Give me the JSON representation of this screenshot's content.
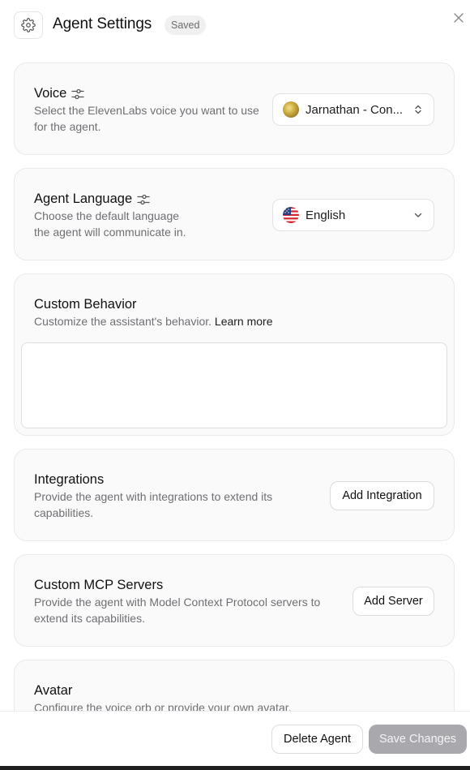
{
  "header": {
    "title": "Agent Settings",
    "badge": "Saved"
  },
  "voice": {
    "title": "Voice",
    "description": "Select the ElevenLabs voice you want to use for the agent.",
    "selected": "Jarnathan - Con..."
  },
  "language": {
    "title": "Agent Language",
    "description_line1": "Choose the default language",
    "description_line2": "the agent will communicate in.",
    "selected": "English"
  },
  "behavior": {
    "title": "Custom Behavior",
    "description": "Customize the assistant's behavior.",
    "learn_more": "Learn more",
    "value": ""
  },
  "integrations": {
    "title": "Integrations",
    "description": "Provide the agent with integrations to extend its capabilities.",
    "button": "Add Integration"
  },
  "mcp": {
    "title": "Custom MCP Servers",
    "description": "Provide the agent with Model Context Protocol servers to extend its capabilities.",
    "button": "Add Server"
  },
  "avatar": {
    "title": "Avatar",
    "description": "Configure the voice orb or provide your own avatar."
  },
  "footer": {
    "delete": "Delete Agent",
    "save": "Save Changes"
  },
  "colors": {
    "accent_disabled": "#a9a9ad",
    "card_bg": "#fafafa",
    "border": "#e9e9ec"
  },
  "icons": {
    "settings": "gear-icon",
    "close": "close-icon",
    "tune": "sliders-icon",
    "sort": "chevron-up-down-icon",
    "dropdown": "chevron-down-icon",
    "flag": "us-flag-icon"
  }
}
